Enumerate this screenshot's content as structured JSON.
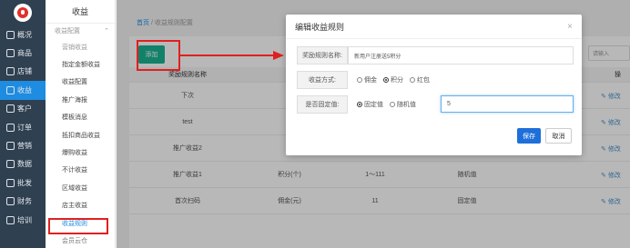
{
  "sidebar": {
    "items": [
      {
        "label": "概况",
        "icon": "home-icon",
        "active": false
      },
      {
        "label": "商品",
        "icon": "tag-icon",
        "active": false
      },
      {
        "label": "店铺",
        "icon": "store-icon",
        "active": false
      },
      {
        "label": "收益",
        "icon": "coin-icon",
        "active": true
      },
      {
        "label": "客户",
        "icon": "user-icon",
        "active": false
      },
      {
        "label": "订单",
        "icon": "order-icon",
        "active": false
      },
      {
        "label": "营销",
        "icon": "gift-icon",
        "active": false
      },
      {
        "label": "数据",
        "icon": "chart-icon",
        "active": false
      },
      {
        "label": "批发",
        "icon": "wholesale-icon",
        "active": false
      },
      {
        "label": "财务",
        "icon": "finance-icon",
        "active": false
      },
      {
        "label": "培训",
        "icon": "training-icon",
        "active": false
      }
    ]
  },
  "submenu": {
    "title": "收益",
    "group": "收益配置",
    "items": [
      "营销收益",
      "指定金额收益",
      "收益配置",
      "推广海报",
      "模板消息",
      "抵扣商品收益",
      "爆购收益",
      "不计收益",
      "区域收益",
      "店主收益",
      "收益规则",
      "会员云仓"
    ]
  },
  "breadcrumb": {
    "home": "首页",
    "sep": "/",
    "current": "收益规则配置"
  },
  "toolbar": {
    "add_label": "添加",
    "search_placeholder": "请输入"
  },
  "table": {
    "headers": [
      "奖励规则名称",
      "奖"
    ],
    "op_header": "操",
    "rows": [
      {
        "name": "下次",
        "type": "",
        "range": "",
        "mode": "",
        "op": "修改"
      },
      {
        "name": "test",
        "type": "",
        "range": "",
        "mode": "",
        "op": "修改"
      },
      {
        "name": "推广收益2",
        "type": "",
        "range": "",
        "mode": "",
        "op": "修改"
      },
      {
        "name": "推广收益1",
        "type": "积分(个)",
        "range": "1～111",
        "mode": "随机值",
        "op": "修改"
      },
      {
        "name": "首次扫码",
        "type": "佣金(元)",
        "range": "11",
        "mode": "固定值",
        "op": "修改"
      }
    ]
  },
  "modal": {
    "title": "编辑收益规则",
    "close": "×",
    "name_label": "奖励规则名称:",
    "name_value": "新用户注册送5积分",
    "type_label": "收益方式:",
    "type_options": [
      "佣金",
      "积分",
      "红包"
    ],
    "type_selected": "积分",
    "fixed_label": "是否固定值:",
    "fixed_options": [
      "固定值",
      "随机值"
    ],
    "fixed_selected": "固定值",
    "value": "5",
    "save_label": "保存",
    "cancel_label": "取消"
  }
}
